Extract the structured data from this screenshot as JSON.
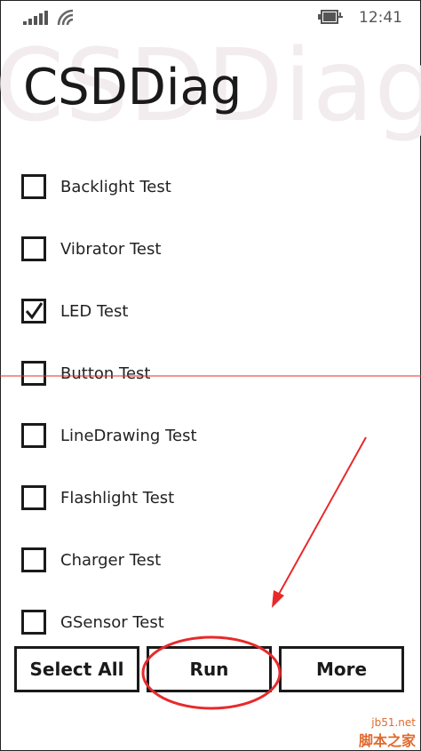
{
  "status_bar": {
    "time": "12:41",
    "signal_icon": "signal-strength-icon",
    "wifi_icon": "wifi-icon",
    "battery_icon": "battery-charging-icon"
  },
  "app": {
    "title": "CSDDiag",
    "watermark": "CSDDiag"
  },
  "tests": [
    {
      "label": "Backlight Test",
      "checked": false
    },
    {
      "label": "Vibrator Test",
      "checked": false
    },
    {
      "label": "LED Test",
      "checked": true
    },
    {
      "label": "Button Test",
      "checked": false
    },
    {
      "label": "LineDrawing Test",
      "checked": false
    },
    {
      "label": "Flashlight Test",
      "checked": false
    },
    {
      "label": "Charger Test",
      "checked": false
    },
    {
      "label": "GSensor Test",
      "checked": false
    }
  ],
  "buttons": {
    "select_all": "Select All",
    "run": "Run",
    "more": "More"
  },
  "annotation": {
    "color": "#e8292b"
  },
  "watermark_site": {
    "domain": "jb51.net",
    "name": "脚本之家"
  }
}
